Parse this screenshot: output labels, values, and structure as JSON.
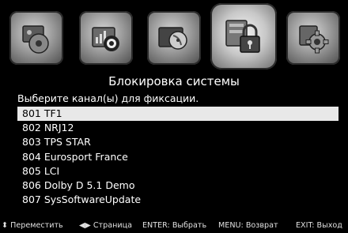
{
  "icons": [
    {
      "name": "media-icon"
    },
    {
      "name": "signal-icon"
    },
    {
      "name": "satellite-icon"
    },
    {
      "name": "lock-icon"
    },
    {
      "name": "settings-icon"
    }
  ],
  "header": {
    "title": "Блокировка системы",
    "subtitle": "Выберите канал(ы) для фиксации."
  },
  "channels": [
    {
      "label": "801 TF1"
    },
    {
      "label": "802 NRJ12"
    },
    {
      "label": "803 TPS STAR"
    },
    {
      "label": "804 Eurosport France"
    },
    {
      "label": "805 LCI"
    },
    {
      "label": "806 Dolby D 5.1 Demo"
    },
    {
      "label": "807 SysSoftwareUpdate"
    }
  ],
  "selected_index": 0,
  "footer": {
    "move": "Переместить",
    "page": "Страница",
    "enter": "ENTER: Выбрать",
    "menu": "MENU: Возврат",
    "exit": "EXIT: Выход"
  },
  "colors": {
    "background": "#000000",
    "highlight": "#e8e8e8",
    "text": "#ffffff"
  }
}
